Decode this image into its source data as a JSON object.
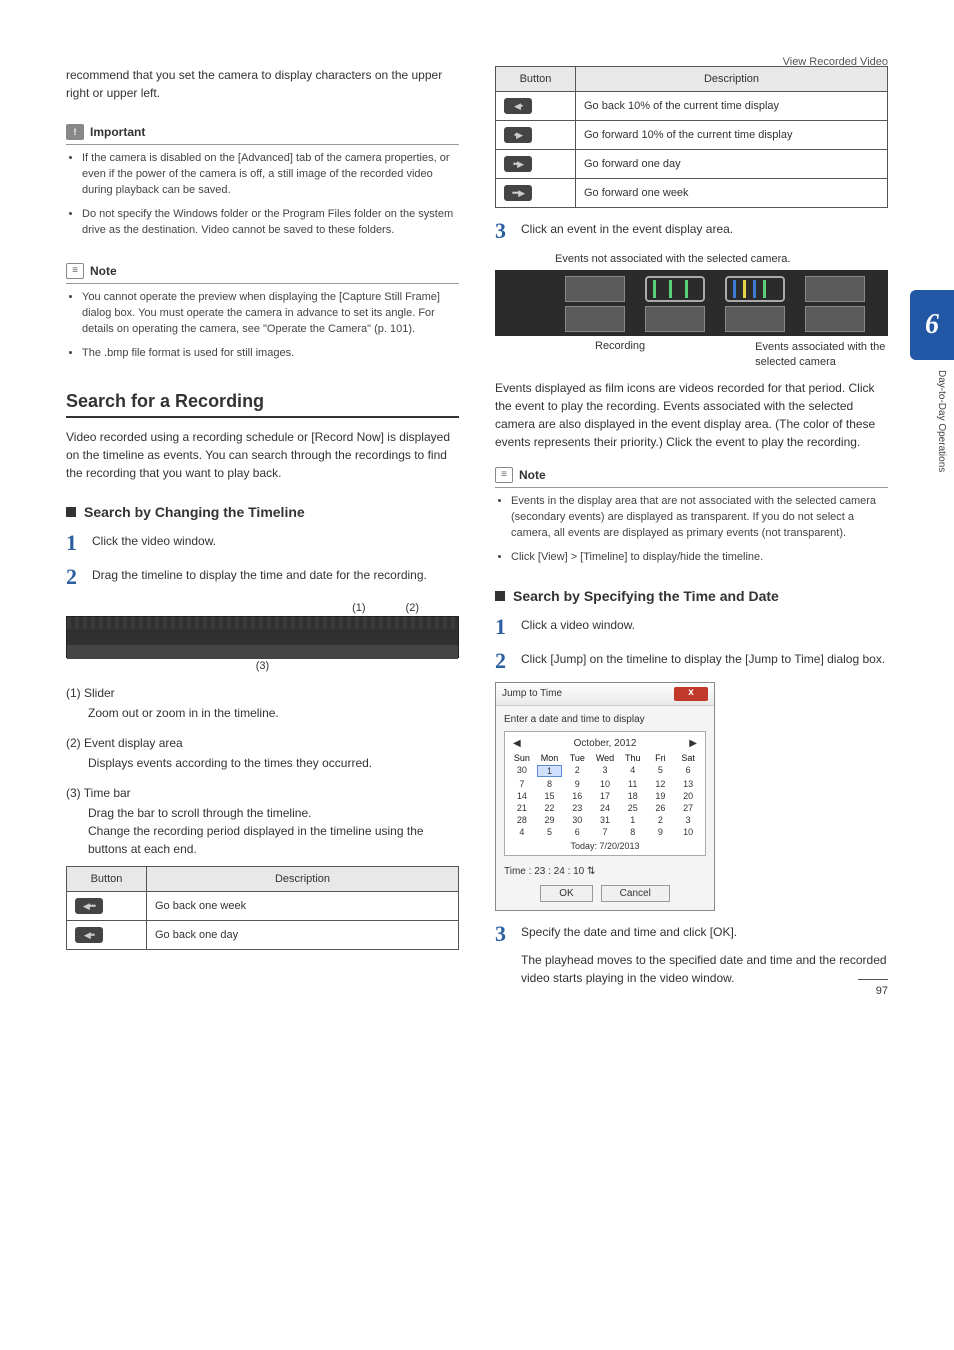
{
  "header": {
    "section": "View Recorded Video"
  },
  "chapter": {
    "num": "6",
    "side_label": "Day-to-Day Operations"
  },
  "left": {
    "intro": "recommend that you set the camera to display characters on the upper right or upper left.",
    "important_label": "Important",
    "important": [
      "If the camera is disabled on the [Advanced] tab of the camera properties, or even if the power of the camera is off, a still image of the recorded video during playback can be saved.",
      "Do not specify the Windows folder or the Program Files folder on the system drive as the destination. Video cannot be saved to these folders."
    ],
    "note_label": "Note",
    "notes": [
      "You cannot operate the preview when displaying the [Capture Still Frame] dialog box. You must operate the camera in advance to set its angle. For details on operating the camera, see \"Operate the Camera\" (p. 101).",
      "The .bmp file format is used for still images."
    ],
    "h2": "Search for a Recording",
    "body": "Video recorded using a recording schedule or [Record Now] is displayed on the timeline as events. You can search through the recordings to find the recording that you want to play back.",
    "h3a": "Search by Changing the Timeline",
    "step1": "Click the video window.",
    "step2": "Drag the timeline to display the time and date for the recording.",
    "annots": {
      "a1": "(1)",
      "a2": "(2)",
      "a3": "(3)"
    },
    "defs": [
      {
        "term": "(1) Slider",
        "body": "Zoom out or zoom in in the timeline."
      },
      {
        "term": "(2) Event display area",
        "body": "Displays events according to the times they occurred."
      },
      {
        "term": "(3) Time bar",
        "body": "Drag the bar to scroll through the timeline.\nChange the recording period displayed in the timeline using the buttons at each end."
      }
    ],
    "table_head": {
      "c1": "Button",
      "c2": "Description"
    },
    "table_rows_left": [
      {
        "icon": "◀•••",
        "desc": "Go back one week"
      },
      {
        "icon": "◀••",
        "desc": "Go back one day"
      }
    ]
  },
  "right": {
    "table_head": {
      "c1": "Button",
      "c2": "Description"
    },
    "table_rows": [
      {
        "icon": "◀•",
        "desc": "Go back 10% of the current time display"
      },
      {
        "icon": "•▶",
        "desc": "Go forward 10% of the current time display"
      },
      {
        "icon": "••▶",
        "desc": "Go forward one day"
      },
      {
        "icon": "•••▶",
        "desc": "Go forward one week"
      }
    ],
    "step3": "Click an event in the event display area.",
    "ev_caption_top": "Events not associated with the selected camera.",
    "ev_caption_l": "Recording",
    "ev_caption_r": "Events associated with the selected camera",
    "ev_body": "Events displayed as film icons are videos recorded for that period. Click the event to play the recording. Events associated with the selected camera are also displayed in the event display area. (The color of these events represents their priority.) Click the event to play the recording.",
    "note_label": "Note",
    "notes": [
      "Events in the display area that are not associated with the selected camera (secondary events) are displayed as transparent. If you do not select a camera, all events are displayed as primary events (not transparent).",
      "Click [View] > [Timeline] to display/hide the timeline."
    ],
    "h3b": "Search by Specifying the Time and Date",
    "b_step1": "Click a video window.",
    "b_step2": "Click [Jump] on the timeline to display the [Jump to Time] dialog box.",
    "dialog": {
      "title": "Jump to Time",
      "instruction": "Enter a date and time to display",
      "month": "October, 2012",
      "days": [
        "Sun",
        "Mon",
        "Tue",
        "Wed",
        "Thu",
        "Fri",
        "Sat"
      ],
      "grid": [
        [
          "30",
          "1",
          "2",
          "3",
          "4",
          "5",
          "6"
        ],
        [
          "7",
          "8",
          "9",
          "10",
          "11",
          "12",
          "13"
        ],
        [
          "14",
          "15",
          "16",
          "17",
          "18",
          "19",
          "20"
        ],
        [
          "21",
          "22",
          "23",
          "24",
          "25",
          "26",
          "27"
        ],
        [
          "28",
          "29",
          "30",
          "31",
          "1",
          "2",
          "3"
        ],
        [
          "4",
          "5",
          "6",
          "7",
          "8",
          "9",
          "10"
        ]
      ],
      "today": "Today: 7/20/2013",
      "time_label": "Time :",
      "time_value": "23 : 24 : 10",
      "ok": "OK",
      "cancel": "Cancel"
    },
    "b_step3": "Specify the date and time and click [OK].",
    "b_body3": "The playhead moves to the specified date and time and the recorded video starts playing in the video window."
  },
  "page_number": "97"
}
